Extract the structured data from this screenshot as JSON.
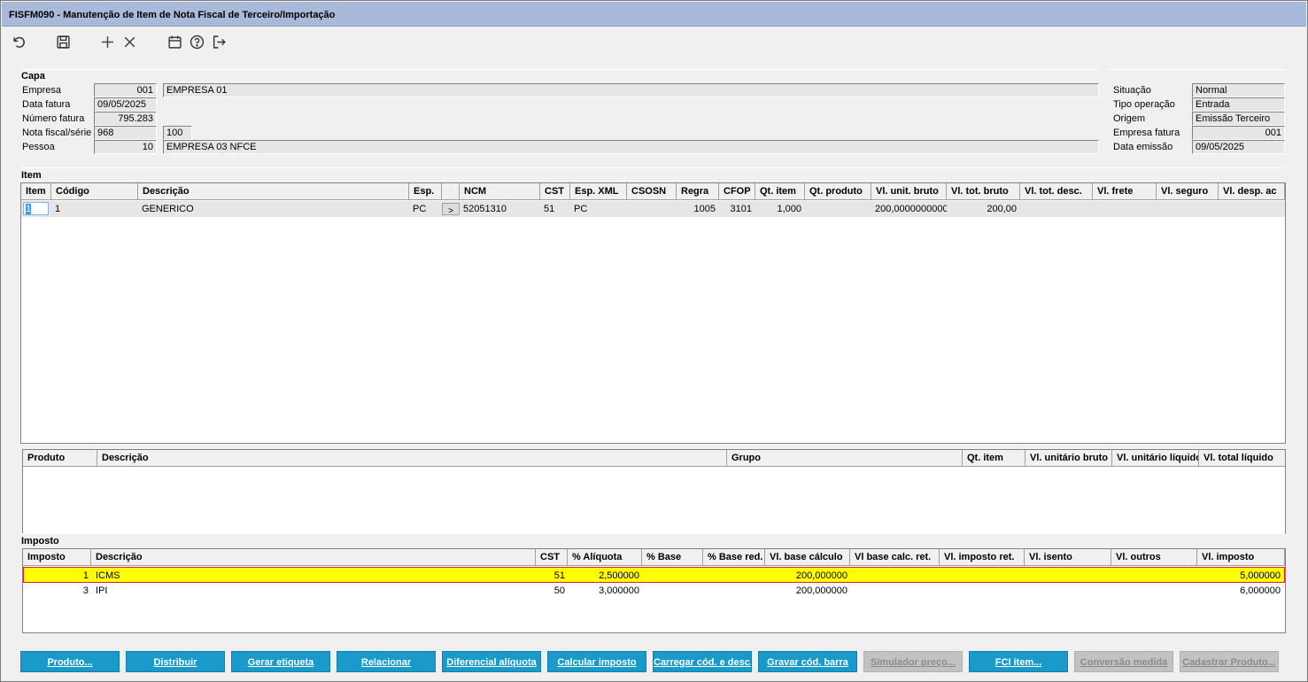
{
  "window": {
    "title": "FISFM090 - Manutenção de Item de Nota Fiscal de Terceiro/Importação"
  },
  "toolbar": {
    "icons": [
      "undo-icon",
      "save-icon",
      "add-icon",
      "delete-icon",
      "calendar-icon",
      "help-icon",
      "exit-icon"
    ]
  },
  "capa": {
    "title": "Capa",
    "empresa_label": "Empresa",
    "empresa_code": "001",
    "empresa_name": "EMPRESA 01",
    "data_fatura_label": "Data fatura",
    "data_fatura": "09/05/2025",
    "numero_fatura_label": "Número fatura",
    "numero_fatura": "795.283",
    "nota_serie_label": "Nota fiscal/série",
    "nota_fiscal": "968",
    "serie": "100",
    "pessoa_label": "Pessoa",
    "pessoa_code": "10",
    "pessoa_name": "EMPRESA 03 NFCE",
    "situacao_label": "Situação",
    "situacao": "Normal",
    "tipo_operacao_label": "Tipo operação",
    "tipo_operacao": "Entrada",
    "origem_label": "Origem",
    "origem": "Emissão Terceiro",
    "empresa_fatura_label": "Empresa fatura",
    "empresa_fatura": "001",
    "data_emissao_label": "Data emissão",
    "data_emissao": "09/05/2025"
  },
  "item": {
    "title": "Item",
    "columns": [
      "Item",
      "Código",
      "Descrição",
      "Esp.",
      "",
      "NCM",
      "CST",
      "Esp. XML",
      "CSOSN",
      "Regra",
      "CFOP",
      "Qt. item",
      "Qt. produto",
      "Vl. unit. bruto",
      "Vl. tot. bruto",
      "Vl. tot. desc.",
      "Vl. frete",
      "Vl. seguro",
      "Vl. desp. ac"
    ],
    "row": {
      "item": "1",
      "codigo": "1",
      "descricao": "GENERICO",
      "esp": "PC",
      "btn": ">",
      "ncm": "52051310",
      "cst": "51",
      "esp_xml": "PC",
      "csosn": "",
      "regra": "1005",
      "cfop": "3101",
      "qt_item": "1,000",
      "qt_produto": "",
      "vl_unit_bruto": "200,0000000000",
      "vl_tot_bruto": "200,00"
    }
  },
  "produto": {
    "columns": [
      "Produto",
      "Descrição",
      "Grupo",
      "Qt. item",
      "Vl. unitário bruto",
      "Vl. unitário líquido",
      "Vl. total líquido"
    ]
  },
  "imposto": {
    "title": "Imposto",
    "columns": [
      "Imposto",
      "Descrição",
      "CST",
      "% Alíquota",
      "% Base",
      "% Base red.",
      "Vl. base cálculo",
      "Vl base calc. ret.",
      "Vl. imposto ret.",
      "Vl. isento",
      "Vl. outros",
      "Vl. imposto"
    ],
    "rows": [
      {
        "imposto": "1",
        "descricao": "ICMS",
        "cst": "51",
        "aliquota": "2,500000",
        "base": "",
        "base_red": "",
        "base_calculo": "200,000000",
        "base_calc_ret": "",
        "imposto_ret": "",
        "isento": "",
        "outros": "",
        "vl_imposto": "5,000000"
      },
      {
        "imposto": "3",
        "descricao": "IPI",
        "cst": "50",
        "aliquota": "3,000000",
        "base": "",
        "base_red": "",
        "base_calculo": "200,000000",
        "base_calc_ret": "",
        "imposto_ret": "",
        "isento": "",
        "outros": "",
        "vl_imposto": "6,000000"
      }
    ]
  },
  "buttons": [
    {
      "label": "Produto...",
      "enabled": true
    },
    {
      "label": "Distribuir",
      "enabled": true
    },
    {
      "label": "Gerar etiqueta",
      "enabled": true
    },
    {
      "label": "Relacionar",
      "enabled": true
    },
    {
      "label": "Diferencial alíquota",
      "enabled": true
    },
    {
      "label": "Calcular imposto",
      "enabled": true
    },
    {
      "label": "Carregar cód. e desc.",
      "enabled": true
    },
    {
      "label": "Gravar cód. barra",
      "enabled": true
    },
    {
      "label": "Simulador preço...",
      "enabled": false
    },
    {
      "label": "FCI item...",
      "enabled": true
    },
    {
      "label": "Conversão medida",
      "enabled": false
    },
    {
      "label": "Cadastrar Produto...",
      "enabled": false
    }
  ],
  "colors": {
    "titlebar": "#a9b9d9",
    "button": "#1a9acb",
    "highlight_row": "#ffff00",
    "highlight_border": "#e0202a"
  }
}
